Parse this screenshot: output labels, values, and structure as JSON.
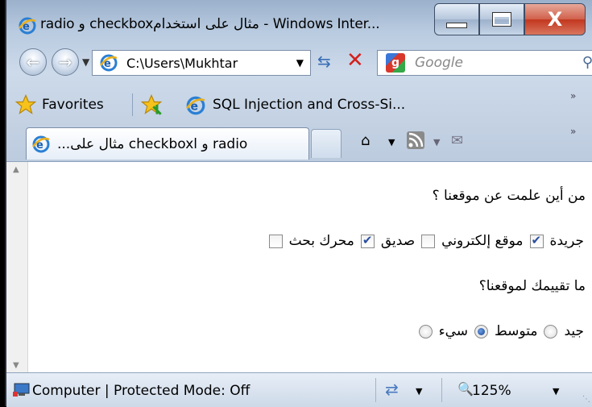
{
  "window": {
    "title": "radio و checkboxمثال على استخدام - Windows Inter...",
    "close_glyph": "X"
  },
  "nav": {
    "address": "C:\\Users\\Mukhtar",
    "search_placeholder": "Google"
  },
  "favorites": {
    "label": "Favorites",
    "items": [
      {
        "label": "SQL Injection and Cross-Si..."
      }
    ]
  },
  "tabs": [
    {
      "label": "...مثال على checkboxl و radio",
      "active": true
    }
  ],
  "page": {
    "question1": "من أين علمت عن موقعنا ؟",
    "checkboxes": [
      {
        "label": "جريدة",
        "checked": true
      },
      {
        "label": "موقع إلكتروني",
        "checked": false
      },
      {
        "label": "صديق",
        "checked": true
      },
      {
        "label": "محرك بحث",
        "checked": false
      }
    ],
    "question2": "ما تقييمك لموقعنا؟",
    "radios": [
      {
        "label": "جيد",
        "checked": false
      },
      {
        "label": "متوسط",
        "checked": true
      },
      {
        "label": "سيء",
        "checked": false
      }
    ]
  },
  "status": {
    "text": "Computer | Protected Mode: Off",
    "zoom": "125%"
  },
  "colors": {
    "chrome_blue": "#b9cbe0",
    "close_red": "#c2361d",
    "stop_red": "#d3201d",
    "check_blue": "#2a4fa0"
  }
}
